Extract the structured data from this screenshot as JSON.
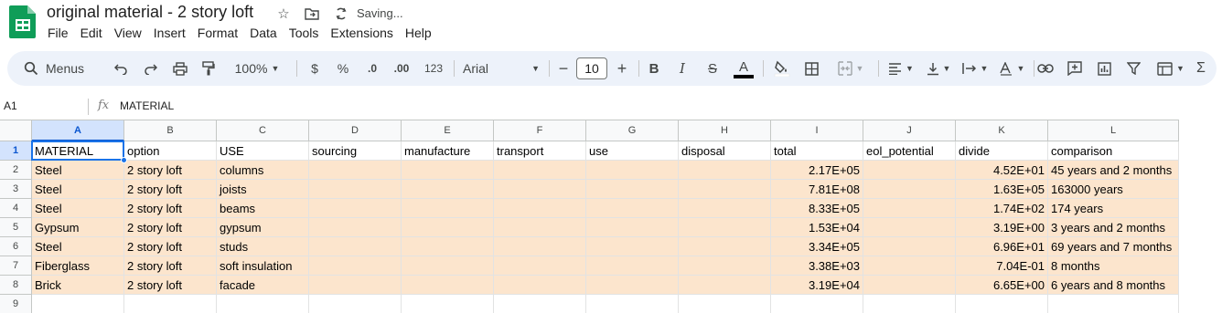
{
  "app": {
    "doc_title": "original material - 2 story loft",
    "saving_status": "Saving...",
    "menu": [
      "File",
      "Edit",
      "View",
      "Insert",
      "Format",
      "Data",
      "Tools",
      "Extensions",
      "Help"
    ]
  },
  "toolbar": {
    "search_label": "Menus",
    "zoom": "100%",
    "currency": "$",
    "percent": "%",
    "decrease_decimal": ".0",
    "increase_decimal": ".00",
    "number_format": "123",
    "font": "Arial",
    "font_size": "10",
    "minus": "−",
    "plus": "+",
    "bold": "B",
    "italic": "I",
    "strikethrough": "S",
    "text_color": "A",
    "text_color_value": "#000000",
    "summation": "Σ"
  },
  "formula_bar": {
    "name_box": "A1",
    "fx": "fx",
    "value": "MATERIAL"
  },
  "grid": {
    "columns": [
      "A",
      "B",
      "C",
      "D",
      "E",
      "F",
      "G",
      "H",
      "I",
      "J",
      "K",
      "L"
    ],
    "selected_column": "A",
    "rows": [
      "1",
      "2",
      "3",
      "4",
      "5",
      "6",
      "7",
      "8",
      "9"
    ],
    "selected_row": "1",
    "fill_color": "#fce5cd",
    "header": [
      "MATERIAL",
      "option",
      "USE",
      "sourcing",
      "manufacture",
      "transport",
      "use",
      "disposal",
      "total",
      "eol_potential",
      "divide",
      "comparison"
    ],
    "data": [
      [
        "Steel",
        "2 story loft",
        "columns",
        "",
        "",
        "",
        "",
        "",
        "2.17E+05",
        "",
        "4.52E+01",
        "45 years and 2 months"
      ],
      [
        "Steel",
        "2 story loft",
        "joists",
        "",
        "",
        "",
        "",
        "",
        "7.81E+08",
        "",
        "1.63E+05",
        "163000 years"
      ],
      [
        "Steel",
        "2 story loft",
        "beams",
        "",
        "",
        "",
        "",
        "",
        "8.33E+05",
        "",
        "1.74E+02",
        "174 years"
      ],
      [
        "Gypsum",
        "2 story loft",
        "gypsum",
        "",
        "",
        "",
        "",
        "",
        "1.53E+04",
        "",
        "3.19E+00",
        "3 years and 2 months"
      ],
      [
        "Steel",
        "2 story loft",
        "studs",
        "",
        "",
        "",
        "",
        "",
        "3.34E+05",
        "",
        "6.96E+01",
        "69 years and 7 months"
      ],
      [
        "Fiberglass",
        "2 story loft",
        "soft insulation",
        "",
        "",
        "",
        "",
        "",
        "3.38E+03",
        "",
        "7.04E-01",
        "8 months"
      ],
      [
        "Brick",
        "2 story loft",
        "facade",
        "",
        "",
        "",
        "",
        "",
        "3.19E+04",
        "",
        "6.65E+00",
        "6 years and 8 months"
      ]
    ]
  }
}
